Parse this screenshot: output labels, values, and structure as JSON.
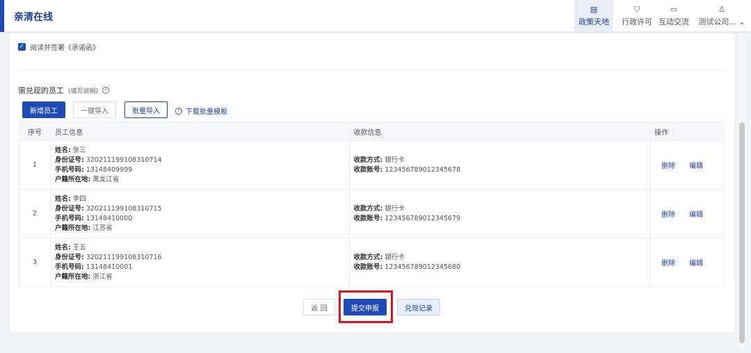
{
  "header": {
    "brand": "亲清在线",
    "nav": [
      {
        "label": "政策天地",
        "icon": "document-icon"
      },
      {
        "label": "行政许可",
        "icon": "shield-icon"
      },
      {
        "label": "互动交流",
        "icon": "chat-icon"
      },
      {
        "label": "测试公司...",
        "icon": "user-icon"
      }
    ]
  },
  "agreement": {
    "label": "阅读并签署《承诺函》"
  },
  "employees": {
    "title": "需兑现的员工",
    "note": "(填写说明)",
    "buttons": {
      "add": "新增员工",
      "one_click": "一键导入",
      "batch": "批量导入",
      "download": "下载批量模板"
    },
    "columns": {
      "index": "序号",
      "employee": "员工信息",
      "payment": "收款信息",
      "actions": "操作"
    },
    "labels": {
      "name": "姓名:",
      "id": "身份证号:",
      "phone": "手机号码:",
      "hukou": "户籍所在地:",
      "method": "收款方式:",
      "account": "收款账号:"
    },
    "ops": {
      "delete": "删除",
      "edit": "编辑"
    },
    "rows": [
      {
        "index": "1",
        "name": "张三",
        "id": "320211199108310714",
        "phone": "13148409999",
        "hukou": "黑龙江省",
        "method": "银行卡",
        "account": "123456789012345678"
      },
      {
        "index": "2",
        "name": "李四",
        "id": "320211199108310715",
        "phone": "13148410000",
        "hukou": "江苏省",
        "method": "银行卡",
        "account": "123456789012345679"
      },
      {
        "index": "3",
        "name": "王五",
        "id": "320211199108310716",
        "phone": "13148410001",
        "hukou": "浙江省",
        "method": "银行卡",
        "account": "123456789012345680"
      }
    ]
  },
  "footer": {
    "back": "返 回",
    "submit": "提交申报",
    "records": "兑现记录"
  },
  "colors": {
    "primary": "#1f4bb4",
    "highlight": "#d9141f"
  }
}
